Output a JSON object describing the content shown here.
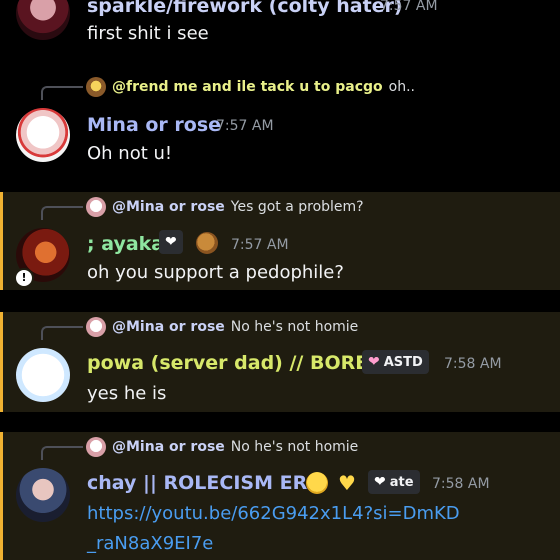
{
  "messages": [
    {
      "author": "sparkle/firework (colty hater)",
      "time": "7:57 AM",
      "text": "first shit i see"
    },
    {
      "reply_to": "@frend me and ile tack u to pacgo",
      "reply_text": "oh..",
      "author": "Mina or rose",
      "time": "7:57 AM",
      "text": "Oh not u!"
    },
    {
      "reply_to": "@Mina or rose",
      "reply_text": "Yes got a problem?",
      "author": "; ayaka",
      "time": "7:57 AM",
      "text": "oh you support a pedophile?"
    },
    {
      "reply_to": "@Mina or rose",
      "reply_text": "No he's not homie",
      "author": "powa (server dad) // BORED",
      "tag": "ASTD",
      "time": "7:58 AM",
      "text": "yes he is"
    },
    {
      "reply_to": "@Mina or rose",
      "reply_text": "No he's not homie",
      "author": "chay || ROLECISM ERA",
      "tag": "ate",
      "time": "7:58 AM",
      "link_line1": "https://youtu.be/662G942x1L4?si=DmKD",
      "link_line2": "_raN8aX9EI7e"
    }
  ],
  "colors": {
    "background": "#000000",
    "mention_highlight": "#1f1c10",
    "mention_bar": "#f0b232",
    "link": "#4a9df0",
    "timestamp": "#949ba4"
  }
}
